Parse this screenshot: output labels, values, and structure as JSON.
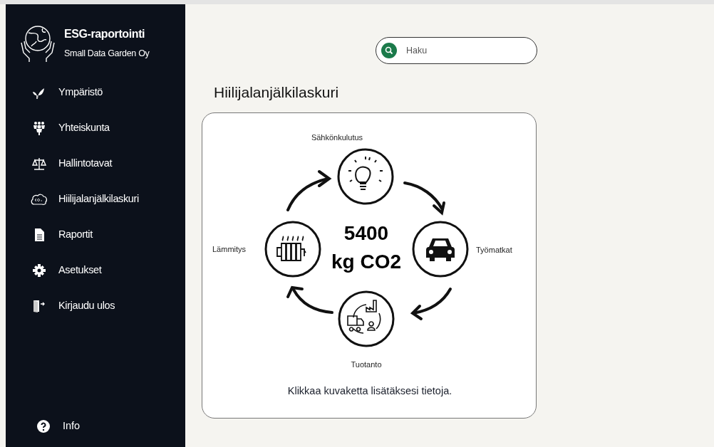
{
  "brand": {
    "title": "ESG-raportointi",
    "subtitle": "Small Data Garden Oy"
  },
  "sidebar": {
    "items": [
      {
        "kind": "leaf",
        "label": "Ympäristö"
      },
      {
        "kind": "people",
        "label": "Yhteiskunta"
      },
      {
        "kind": "scales",
        "label": "Hallintotavat"
      },
      {
        "kind": "cloud",
        "label": "Hiilijalanjälkilaskuri"
      },
      {
        "kind": "document",
        "label": "Raportit"
      },
      {
        "kind": "gear",
        "label": "Asetukset"
      },
      {
        "kind": "door",
        "label": "Kirjaudu ulos"
      }
    ],
    "footer": {
      "kind": "help",
      "label": "Info"
    }
  },
  "search": {
    "placeholder": "Haku"
  },
  "page_title": "Hiilijalanjälkilaskuri",
  "calculator": {
    "nodes": [
      {
        "kind": "electricity",
        "label": "Sähkönkulutus"
      },
      {
        "kind": "heating",
        "label": "Lämmitys"
      },
      {
        "kind": "commute",
        "label": "Työmatkat"
      },
      {
        "kind": "production",
        "label": "Tuotanto"
      }
    ],
    "total": [
      "5400",
      "kg CO2"
    ],
    "hint": "Klikkaa kuvaketta lisätäksesi tietoja."
  }
}
